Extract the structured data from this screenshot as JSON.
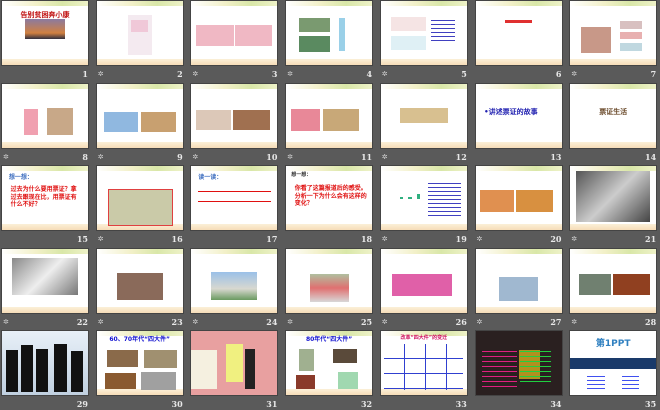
{
  "view": "slide-sorter",
  "slides": [
    {
      "number": "1",
      "has_animation": false,
      "title": "告别贫困奔小康",
      "lines": []
    },
    {
      "number": "2",
      "has_animation": true,
      "title": "",
      "lines": []
    },
    {
      "number": "3",
      "has_animation": true,
      "title": "",
      "lines": []
    },
    {
      "number": "4",
      "has_animation": true,
      "title": "",
      "lines": []
    },
    {
      "number": "5",
      "has_animation": true,
      "title": "",
      "lines": []
    },
    {
      "number": "6",
      "has_animation": false,
      "title": "",
      "lines": []
    },
    {
      "number": "7",
      "has_animation": true,
      "title": "",
      "lines": []
    },
    {
      "number": "8",
      "has_animation": true,
      "title": "",
      "lines": []
    },
    {
      "number": "9",
      "has_animation": true,
      "title": "",
      "lines": []
    },
    {
      "number": "10",
      "has_animation": true,
      "title": "",
      "lines": []
    },
    {
      "number": "11",
      "has_animation": true,
      "title": "",
      "lines": []
    },
    {
      "number": "12",
      "has_animation": true,
      "title": "",
      "lines": []
    },
    {
      "number": "13",
      "has_animation": false,
      "title": "•讲述票证的故事",
      "lines": []
    },
    {
      "number": "14",
      "has_animation": false,
      "title": "票证生活",
      "lines": []
    },
    {
      "number": "15",
      "has_animation": false,
      "title": "想一想：",
      "lines": [
        "过去为什么要用票证？拿过去跟现在比，用票证有什么不好？"
      ]
    },
    {
      "number": "16",
      "has_animation": true,
      "title": "",
      "lines": []
    },
    {
      "number": "17",
      "has_animation": false,
      "title": "读一读：",
      "lines": []
    },
    {
      "number": "18",
      "has_animation": false,
      "title": "想一想：",
      "lines": [
        "你看了这篇报道后的感受。分析一下为什么会有这样的变化？"
      ]
    },
    {
      "number": "19",
      "has_animation": true,
      "title": "",
      "lines": []
    },
    {
      "number": "20",
      "has_animation": true,
      "title": "",
      "lines": []
    },
    {
      "number": "21",
      "has_animation": true,
      "title": "",
      "lines": []
    },
    {
      "number": "22",
      "has_animation": true,
      "title": "",
      "lines": []
    },
    {
      "number": "23",
      "has_animation": true,
      "title": "",
      "lines": []
    },
    {
      "number": "24",
      "has_animation": true,
      "title": "",
      "lines": []
    },
    {
      "number": "25",
      "has_animation": true,
      "title": "",
      "lines": []
    },
    {
      "number": "26",
      "has_animation": true,
      "title": "",
      "lines": []
    },
    {
      "number": "27",
      "has_animation": true,
      "title": "",
      "lines": []
    },
    {
      "number": "28",
      "has_animation": true,
      "title": "",
      "lines": []
    },
    {
      "number": "29",
      "has_animation": false,
      "title": "",
      "lines": []
    },
    {
      "number": "30",
      "has_animation": false,
      "title": "60、70年代“四大件”",
      "lines": []
    },
    {
      "number": "31",
      "has_animation": false,
      "title": "",
      "lines": []
    },
    {
      "number": "32",
      "has_animation": false,
      "title": "80年代“四大件”",
      "lines": []
    },
    {
      "number": "33",
      "has_animation": false,
      "title": "改革“四大件”的变迁",
      "lines": []
    },
    {
      "number": "34",
      "has_animation": false,
      "title": "",
      "lines": []
    },
    {
      "number": "35",
      "has_animation": false,
      "title": "第1PPT",
      "lines": []
    }
  ],
  "icons": {
    "animation": "slide-transition-icon"
  },
  "colors": {
    "background": "#5a5a5a",
    "slide_number": "#e8e8e8"
  }
}
